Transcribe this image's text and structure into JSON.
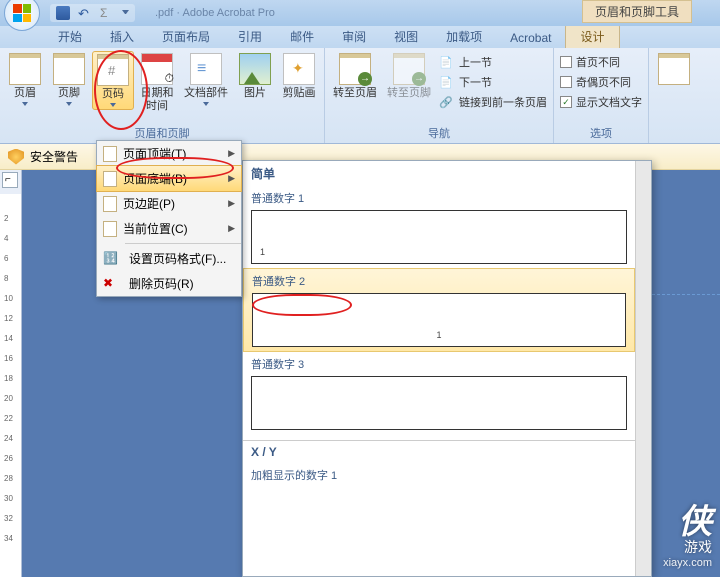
{
  "titlebar": {
    "context_tab": "页眉和页脚工具",
    "doc_hint": ".pdf · Adobe Acrobat Pro"
  },
  "tabs": [
    "开始",
    "插入",
    "页面布局",
    "引用",
    "邮件",
    "审阅",
    "视图",
    "加载项",
    "Acrobat",
    "设计"
  ],
  "ribbon": {
    "group1": {
      "label": "页眉和页脚",
      "header": "页眉",
      "footer": "页脚",
      "pagenum": "页码",
      "datetime1": "日期和",
      "datetime2": "时间",
      "parts": "文档部件",
      "picture": "图片",
      "clipart": "剪贴画"
    },
    "nav": {
      "label": "导航",
      "goto_header": "转至页眉",
      "goto_footer": "转至页脚",
      "prev": "上一节",
      "next": "下一节",
      "link": "链接到前一条页眉"
    },
    "options": {
      "label": "选项",
      "diff_first": "首页不同",
      "diff_odd": "奇偶页不同",
      "show_text": "显示文档文字"
    }
  },
  "security": {
    "label": "安全警告"
  },
  "dropdown": {
    "top": "页面顶端(T)",
    "bottom": "页面底端(B)",
    "margin": "页边距(P)",
    "current": "当前位置(C)",
    "format": "设置页码格式(F)...",
    "remove": "删除页码(R)"
  },
  "gallery": {
    "hdr_simple": "简单",
    "item1": "普通数字 1",
    "item2": "普通数字 2",
    "item3": "普通数字 3",
    "hdr_xy": "X / Y",
    "item4": "加粗显示的数字 1",
    "sample": "1"
  },
  "ruler_ticks": [
    "",
    "2",
    "4",
    "6",
    "8",
    "10",
    "12",
    "14",
    "16",
    "18",
    "20",
    "22",
    "24",
    "26",
    "28",
    "30",
    "32",
    "34"
  ],
  "watermark": {
    "logo": "侠",
    "sub": "游戏",
    "url": "xiayx.com"
  }
}
